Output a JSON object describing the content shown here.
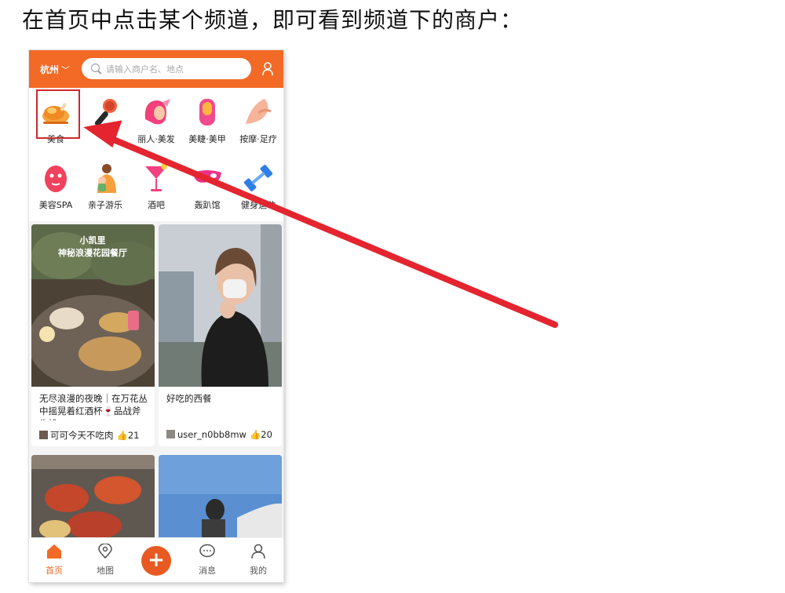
{
  "caption": "在首页中点击某个频道，即可看到频道下的商户：",
  "topbar": {
    "city": "杭州",
    "search_placeholder": "请输入商户名、地点"
  },
  "channels": [
    {
      "label": "美食",
      "icon": "roast-chicken-icon"
    },
    {
      "label": "",
      "icon": "microphone-icon"
    },
    {
      "label": "丽人·美发",
      "icon": "hair-salon-icon"
    },
    {
      "label": "美睫·美甲",
      "icon": "nail-icon"
    },
    {
      "label": "按摩·足疗",
      "icon": "massage-icon"
    },
    {
      "label": "美容SPA",
      "icon": "face-mask-icon"
    },
    {
      "label": "亲子游乐",
      "icon": "parent-child-icon"
    },
    {
      "label": "酒吧",
      "icon": "cocktail-icon"
    },
    {
      "label": "轰趴馆",
      "icon": "party-mask-icon"
    },
    {
      "label": "健身运动",
      "icon": "dumbbell-icon"
    }
  ],
  "feed": [
    {
      "photo_text_line1": "小凯里",
      "photo_text_line2": "神秘浪漫花园餐厅",
      "title": "无尽浪漫的夜晚｜在万花丛中摇晃着红酒杯🍷品战斧牛排",
      "author": "可可今天不吃肉",
      "likes": "21"
    },
    {
      "photo_text_line1": "",
      "photo_text_line2": "",
      "title": "好吃的西餐",
      "author": "user_n0bb8mw",
      "likes": "20"
    },
    {
      "photo_text_line1": "",
      "photo_text_line2": "",
      "title": "",
      "author": "",
      "likes": ""
    },
    {
      "photo_text_line1": "",
      "photo_text_line2": "",
      "title": "",
      "author": "",
      "likes": ""
    }
  ],
  "tabbar": [
    {
      "label": "首页",
      "active": true
    },
    {
      "label": "地图",
      "active": false
    },
    {
      "label": "消息",
      "active": false
    },
    {
      "label": "我的",
      "active": false
    }
  ],
  "colors": {
    "accent": "#f26a26",
    "highlight": "#d0282b",
    "arrow": "#e4252f"
  }
}
